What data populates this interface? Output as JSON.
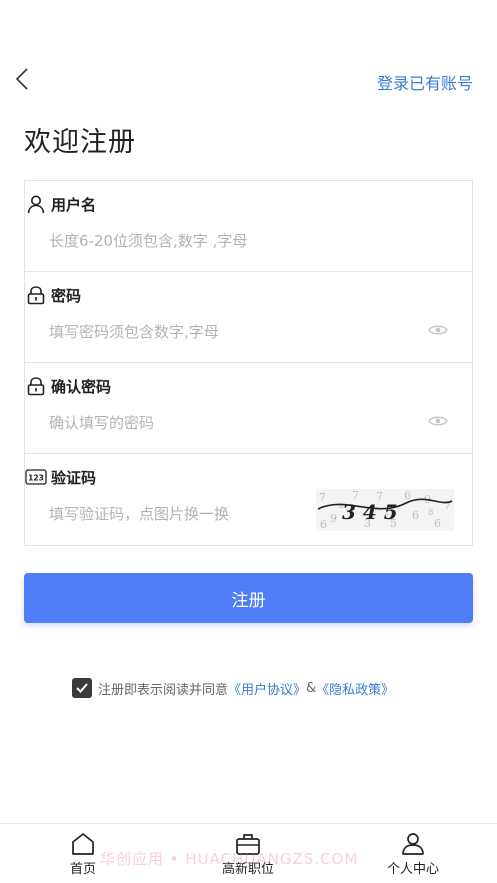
{
  "header": {
    "back_icon": "chevron-left-icon",
    "login_link": "登录已有账号"
  },
  "title": "欢迎注册",
  "form": {
    "username": {
      "label": "用户名",
      "placeholder": "长度6-20位须包含,数字 ,字母",
      "icon": "user-icon"
    },
    "password": {
      "label": "密码",
      "placeholder": "填写密码须包含数字,字母",
      "icon": "lock-icon"
    },
    "confirm_password": {
      "label": "确认密码",
      "placeholder": "确认填写的密码",
      "icon": "lock-icon"
    },
    "captcha": {
      "label": "验证码",
      "placeholder": "填写验证码，点图片换一换",
      "icon": "numbers-123-icon",
      "image_text": "3 4 5"
    }
  },
  "submit_label": "注册",
  "agreement": {
    "checked": true,
    "text": "注册即表示阅读并同意",
    "user_agreement": "《用户协议》",
    "connector": "&",
    "privacy_policy": "《隐私政策》"
  },
  "tabbar": {
    "items": [
      {
        "label": "首页",
        "icon": "home-icon"
      },
      {
        "label": "高新职位",
        "icon": "briefcase-icon"
      },
      {
        "label": "个人中心",
        "icon": "person-icon"
      }
    ]
  },
  "watermark": "华创应用 • HUACHUANGZS.COM",
  "colors": {
    "accent": "#4f7df6",
    "link": "#3a7bd5"
  }
}
